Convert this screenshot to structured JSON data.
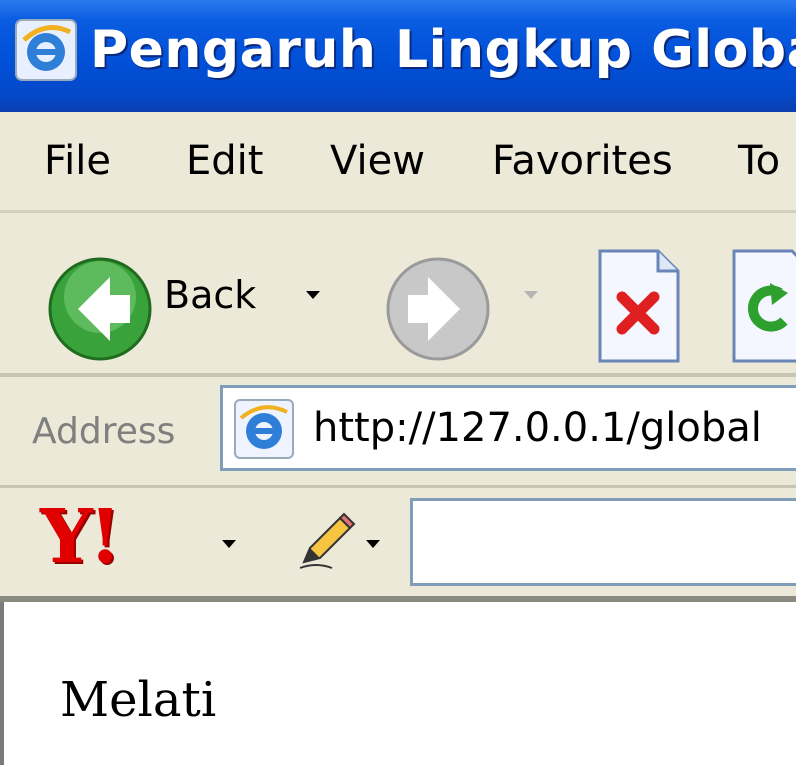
{
  "window": {
    "title": "Pengaruh Lingkup Global -",
    "title_icon": "ie-icon"
  },
  "menu": {
    "items": [
      "File",
      "Edit",
      "View",
      "Favorites",
      "To"
    ]
  },
  "toolbar": {
    "back_label": "Back",
    "icons": [
      "back-arrow-icon",
      "forward-arrow-icon",
      "stop-icon",
      "refresh-icon"
    ]
  },
  "address": {
    "label": "Address",
    "url": "http://127.0.0.1/global"
  },
  "yahoo": {
    "logo": "Y!",
    "search_value": ""
  },
  "page": {
    "text": "Melati"
  },
  "colors": {
    "titlebar": "#0050d8",
    "chrome": "#ece9d8",
    "back_green": "#3aa23a",
    "stop_red": "#e02020",
    "yahoo_red": "#e00000"
  }
}
